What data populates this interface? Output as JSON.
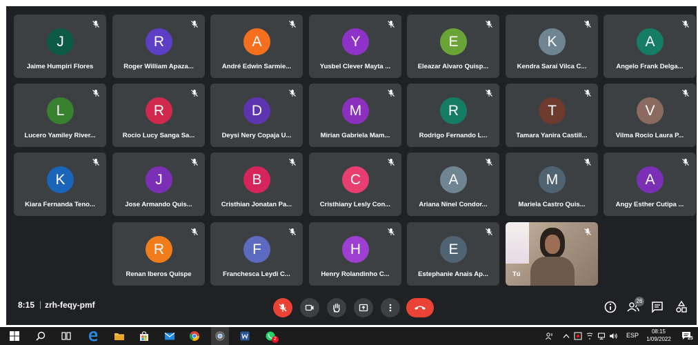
{
  "participants": [
    {
      "initial": "J",
      "name": "Jaime Humpiri Flores",
      "color": "#0d5b46"
    },
    {
      "initial": "R",
      "name": "Roger William Apaza...",
      "color": "#5c3fc4"
    },
    {
      "initial": "A",
      "name": "André Edwin Sarmie...",
      "color": "#f5701e"
    },
    {
      "initial": "Y",
      "name": "Yusbel Clever Mayta ...",
      "color": "#8e32c8"
    },
    {
      "initial": "E",
      "name": "Eleazar Alvaro Quisp...",
      "color": "#6aa336"
    },
    {
      "initial": "K",
      "name": "Kendra Saraí Vilca C...",
      "color": "#6f8592"
    },
    {
      "initial": "A",
      "name": "Angelo Frank Delga...",
      "color": "#157d64"
    },
    {
      "initial": "L",
      "name": "Lucero Yamiley River...",
      "color": "#38812f"
    },
    {
      "initial": "R",
      "name": "Rocio Lucy Sanga Sa...",
      "color": "#d0284f"
    },
    {
      "initial": "D",
      "name": "Deysi Nery Copaja U...",
      "color": "#5e35b1"
    },
    {
      "initial": "M",
      "name": "Mirian Gabriela Mam...",
      "color": "#8b2fbf"
    },
    {
      "initial": "R",
      "name": "Rodrigo Fernando L...",
      "color": "#157d64"
    },
    {
      "initial": "T",
      "name": "Tamara Yanira Castill...",
      "color": "#6d3b2d"
    },
    {
      "initial": "V",
      "name": "Vilma Rocio Laura P...",
      "color": "#8b6a60"
    },
    {
      "initial": "K",
      "name": "Kiara Fernanda Teno...",
      "color": "#1a65b8"
    },
    {
      "initial": "J",
      "name": "Jose Armando Quis...",
      "color": "#7b2fb5"
    },
    {
      "initial": "B",
      "name": "Cristhian Jonatan Pa...",
      "color": "#d6245c"
    },
    {
      "initial": "C",
      "name": "Cristhiany Lesly Con...",
      "color": "#e83f70"
    },
    {
      "initial": "A",
      "name": "Ariana Ninel Condor...",
      "color": "#6f8592"
    },
    {
      "initial": "M",
      "name": "Mariela Castro Quis...",
      "color": "#4f6373"
    },
    {
      "initial": "A",
      "name": "Angy Esther Cutipa ...",
      "color": "#7b2fb5"
    },
    {
      "initial": "R",
      "name": "Renan Iberos Quispe",
      "color": "#f07c1c"
    },
    {
      "initial": "F",
      "name": "Franchesca Leydi C...",
      "color": "#5c6bc0"
    },
    {
      "initial": "H",
      "name": "Henry Rolandinho C...",
      "color": "#9e3fd1"
    },
    {
      "initial": "E",
      "name": "Estephanie Anais Ap...",
      "color": "#4f6373"
    }
  ],
  "self_tile": {
    "name": "Tú"
  },
  "meeting": {
    "time": "8:15",
    "separator": "|",
    "code": "zrh-feqy-pmf",
    "people_count": "26"
  },
  "controls": {
    "mic": "mic-off-icon",
    "camera": "camera-icon",
    "raise_hand": "hand-icon",
    "present": "present-icon",
    "more": "more-vert-icon",
    "end_call": "end-call-icon",
    "mic_off_color": "#ea4335"
  },
  "taskbar": {
    "apps": [
      "windows-start-icon",
      "search-icon",
      "task-view-icon",
      "edge-icon",
      "file-explorer-icon",
      "store-icon",
      "mail-icon",
      "chrome-icon",
      "chrome-active-icon",
      "word-icon",
      "whatsapp-icon"
    ],
    "whatsapp_badge": "2",
    "language": "ESP",
    "clock_time": "08:15",
    "clock_date": "1/09/2022",
    "notification_count": "25"
  }
}
